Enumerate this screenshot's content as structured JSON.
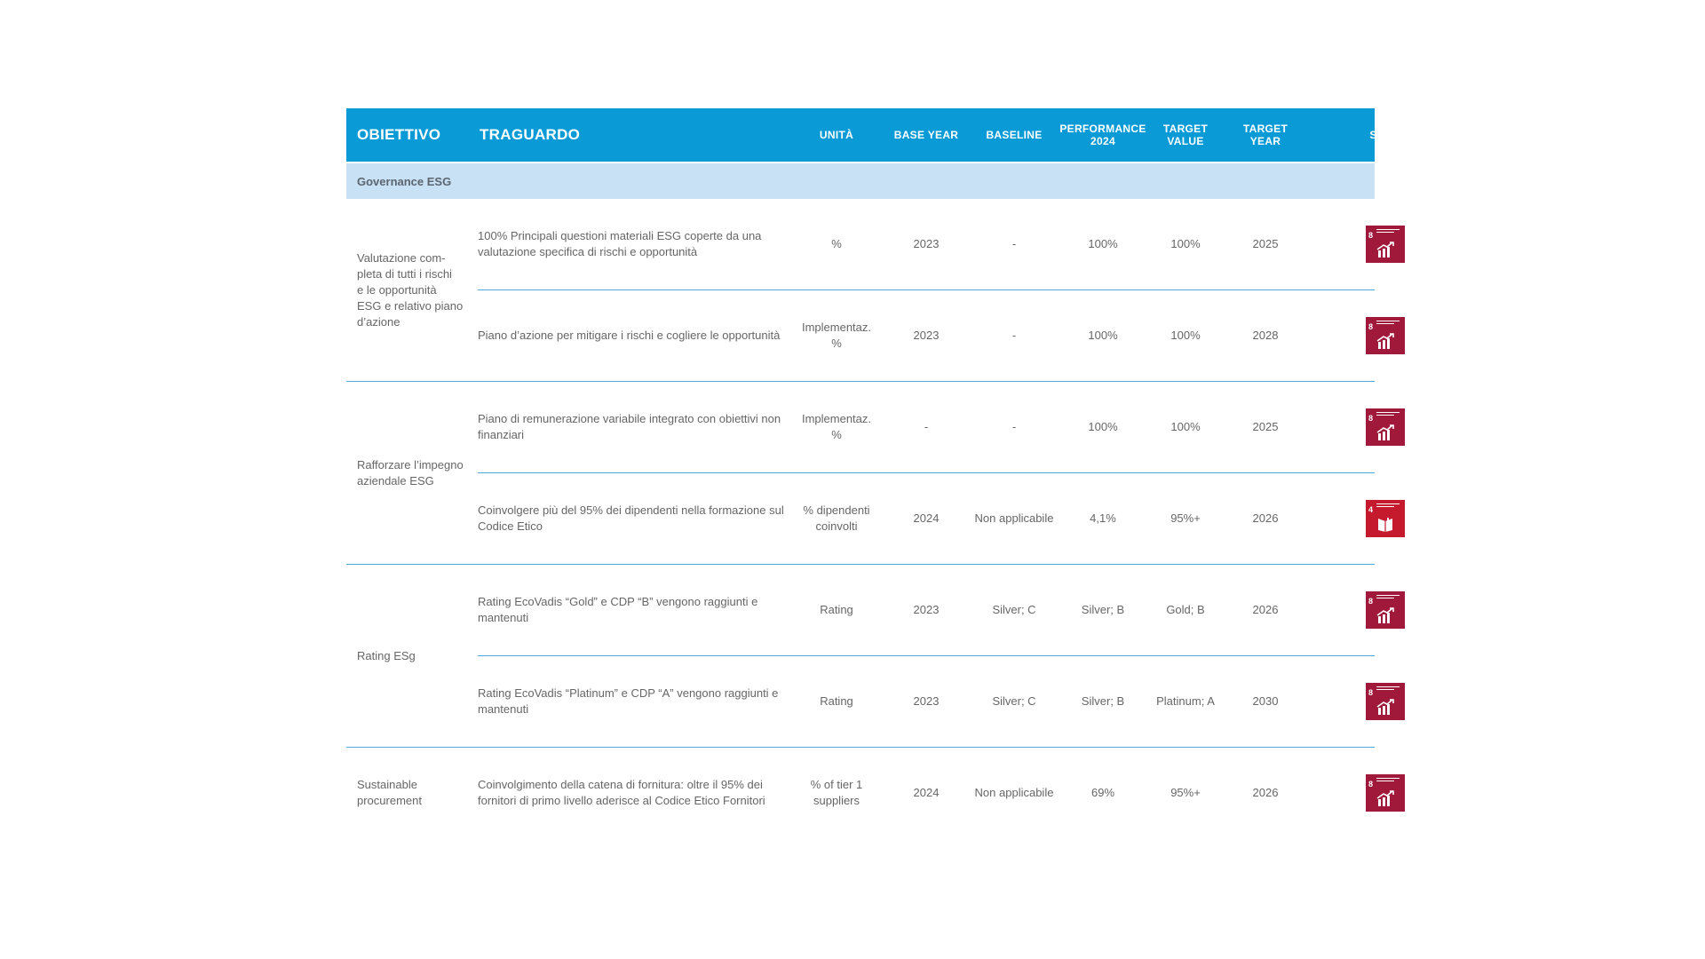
{
  "header": {
    "obiettivo": "OBIETTIVO",
    "traguardo": "TRAGUARDO",
    "unita": "UNITÀ",
    "base_year": "BASE YEAR",
    "baseline": "BASELINE",
    "performance_l1": "PERFORMANCE",
    "performance_l2": "2024",
    "target_value_l1": "TARGET",
    "target_value_l2": "VALUE",
    "target_year_l1": "TARGET",
    "target_year_l2": "YEAR",
    "sdgs": "SDGS"
  },
  "section": {
    "title": "Governance ESG"
  },
  "groups": [
    {
      "obiettivo_lines": [
        "Valutazione com-",
        "pleta di tutti i rischi",
        "e le opportunità",
        "ESG e relativo piano",
        "d’azione"
      ],
      "rows": [
        {
          "traguardo": "100% Principali questioni materiali ESG coperte da una valutazione specifica di rischi e opportunità",
          "unita": "%",
          "base_year": "2023",
          "baseline": "-",
          "performance": "100%",
          "target_value": "100%",
          "target_year": "2025",
          "sdg": {
            "number": "8",
            "icon": "sdg-8-decent-work-icon",
            "color": "#a0193a"
          }
        },
        {
          "traguardo": "Piano d’azione per mitigare i rischi e cogliere le opportunità",
          "unita": "Implementaz. %",
          "base_year": "2023",
          "baseline": "-",
          "performance": "100%",
          "target_value": "100%",
          "target_year": "2028",
          "sdg": {
            "number": "8",
            "icon": "sdg-8-decent-work-icon",
            "color": "#a0193a"
          }
        }
      ]
    },
    {
      "obiettivo_lines": [
        "Rafforzare l’impegno",
        "aziendale ESG"
      ],
      "rows": [
        {
          "traguardo": "Piano di remunerazione variabile integrato con obiettivi non finanziari",
          "unita": "Implementaz. %",
          "base_year": "-",
          "baseline": "-",
          "performance": "100%",
          "target_value": "100%",
          "target_year": "2025",
          "sdg": {
            "number": "8",
            "icon": "sdg-8-decent-work-icon",
            "color": "#a0193a"
          }
        },
        {
          "traguardo": "Coinvolgere più del 95% dei dipendenti nella formazione sul Codice Etico",
          "unita": "% dipendenti coinvolti",
          "base_year": "2024",
          "baseline": "Non applicabile",
          "performance": "4,1%",
          "target_value": "95%+",
          "target_year": "2026",
          "sdg": {
            "number": "4",
            "icon": "sdg-4-quality-education-icon",
            "color": "#c5192d"
          }
        }
      ]
    },
    {
      "obiettivo_lines": [
        "Rating ESg"
      ],
      "rows": [
        {
          "traguardo": "Rating EcoVadis “Gold” e CDP “B” vengono raggiunti e mantenuti",
          "unita": "Rating",
          "base_year": "2023",
          "baseline": "Silver; C",
          "performance": "Silver; B",
          "target_value": "Gold; B",
          "target_year": "2026",
          "sdg": {
            "number": "8",
            "icon": "sdg-8-decent-work-icon",
            "color": "#a0193a"
          }
        },
        {
          "traguardo": "Rating EcoVadis “Platinum” e CDP “A” vengono raggiunti e mantenuti",
          "unita": "Rating",
          "base_year": "2023",
          "baseline": "Silver; C",
          "performance": "Silver; B",
          "target_value": "Platinum; A",
          "target_year": "2030",
          "sdg": {
            "number": "8",
            "icon": "sdg-8-decent-work-icon",
            "color": "#a0193a"
          }
        }
      ]
    },
    {
      "obiettivo_lines": [
        "Sustainable",
        "procurement"
      ],
      "rows": [
        {
          "traguardo": "Coinvolgimento della catena di fornitura: oltre il 95% dei fornitori di primo livello aderisce al Codice Etico Fornitori",
          "unita": "% of tier 1 suppliers",
          "base_year": "2024",
          "baseline": "Non applicabile",
          "performance": "69%",
          "target_value": "95%+",
          "target_year": "2026",
          "sdg": {
            "number": "8",
            "icon": "sdg-8-decent-work-icon",
            "color": "#a0193a"
          }
        }
      ]
    }
  ]
}
